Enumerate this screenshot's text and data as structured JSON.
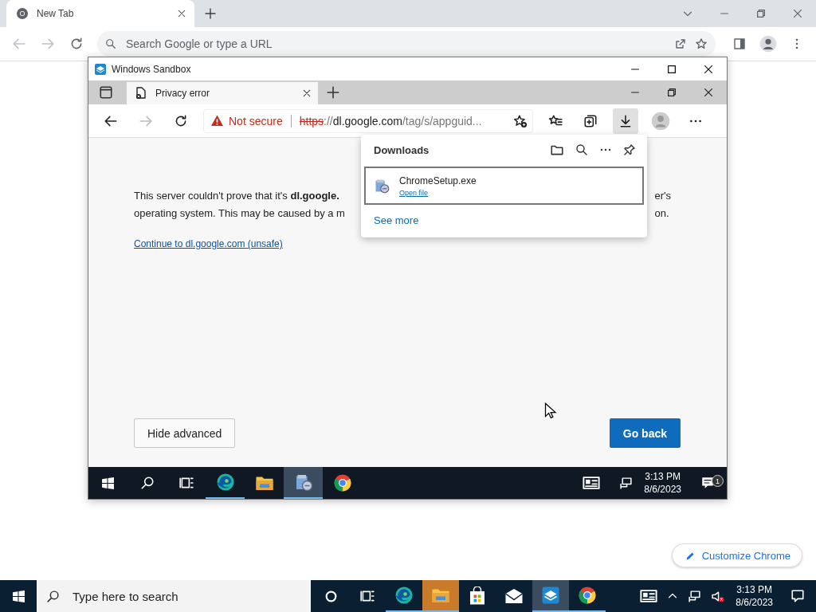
{
  "chrome_window": {
    "tabs": [
      {
        "title": "New Tab",
        "selected": true
      }
    ],
    "omnibox": {
      "placeholder": "Search Google or type a URL"
    },
    "customize_button": "Customize Chrome"
  },
  "sandbox_window": {
    "title": "Windows Sandbox",
    "edge": {
      "tabs": [
        {
          "title": "Privacy error",
          "selected": true
        }
      ],
      "security_label": "Not secure",
      "url": [
        {
          "text": "https",
          "kind": "scheme"
        },
        {
          "text": "://",
          "kind": "dim"
        },
        {
          "text": "dl.google.com",
          "kind": "host"
        },
        {
          "text": "/tag/s/appguid...",
          "kind": "dim"
        }
      ],
      "page": {
        "text_left": [
          "This server couldn't prove that it's **dl.google.**",
          "operating system. This may be caused by a m"
        ],
        "text_right": [
          "er's",
          "on."
        ],
        "proceed_link": "Continue to dl.google.com (unsafe)",
        "buttons": [
          {
            "label": "Hide advanced",
            "kind": "secondary"
          },
          {
            "label": "Go back",
            "kind": "primary"
          }
        ]
      },
      "downloads": {
        "title": "Downloads",
        "items": [
          {
            "file": "ChromeSetup.exe",
            "action": "Open file"
          }
        ],
        "see_more": "See more"
      }
    },
    "taskbar": {
      "apps": [
        {
          "kind": "edge",
          "running": true,
          "selected": false
        },
        {
          "kind": "folder",
          "running": false,
          "selected": false
        },
        {
          "kind": "installer",
          "running": true,
          "selected": true
        },
        {
          "kind": "chrome",
          "running": false,
          "selected": false
        }
      ],
      "time": "3:13 PM",
      "date": "8/6/2023",
      "notification_count": "1"
    }
  },
  "taskbar": {
    "search_placeholder": "Type here to search",
    "apps": [
      {
        "kind": "edge",
        "running": true,
        "selected": false,
        "attention": false
      },
      {
        "kind": "folder",
        "running": true,
        "selected": false,
        "attention": true
      },
      {
        "kind": "store",
        "running": false,
        "selected": false,
        "attention": false
      },
      {
        "kind": "mail",
        "running": false,
        "selected": false,
        "attention": false
      },
      {
        "kind": "sandbox",
        "running": true,
        "selected": true,
        "attention": false
      },
      {
        "kind": "chrome",
        "running": true,
        "selected": false,
        "attention": false
      }
    ],
    "time": "3:13 PM",
    "date": "8/6/2023"
  }
}
